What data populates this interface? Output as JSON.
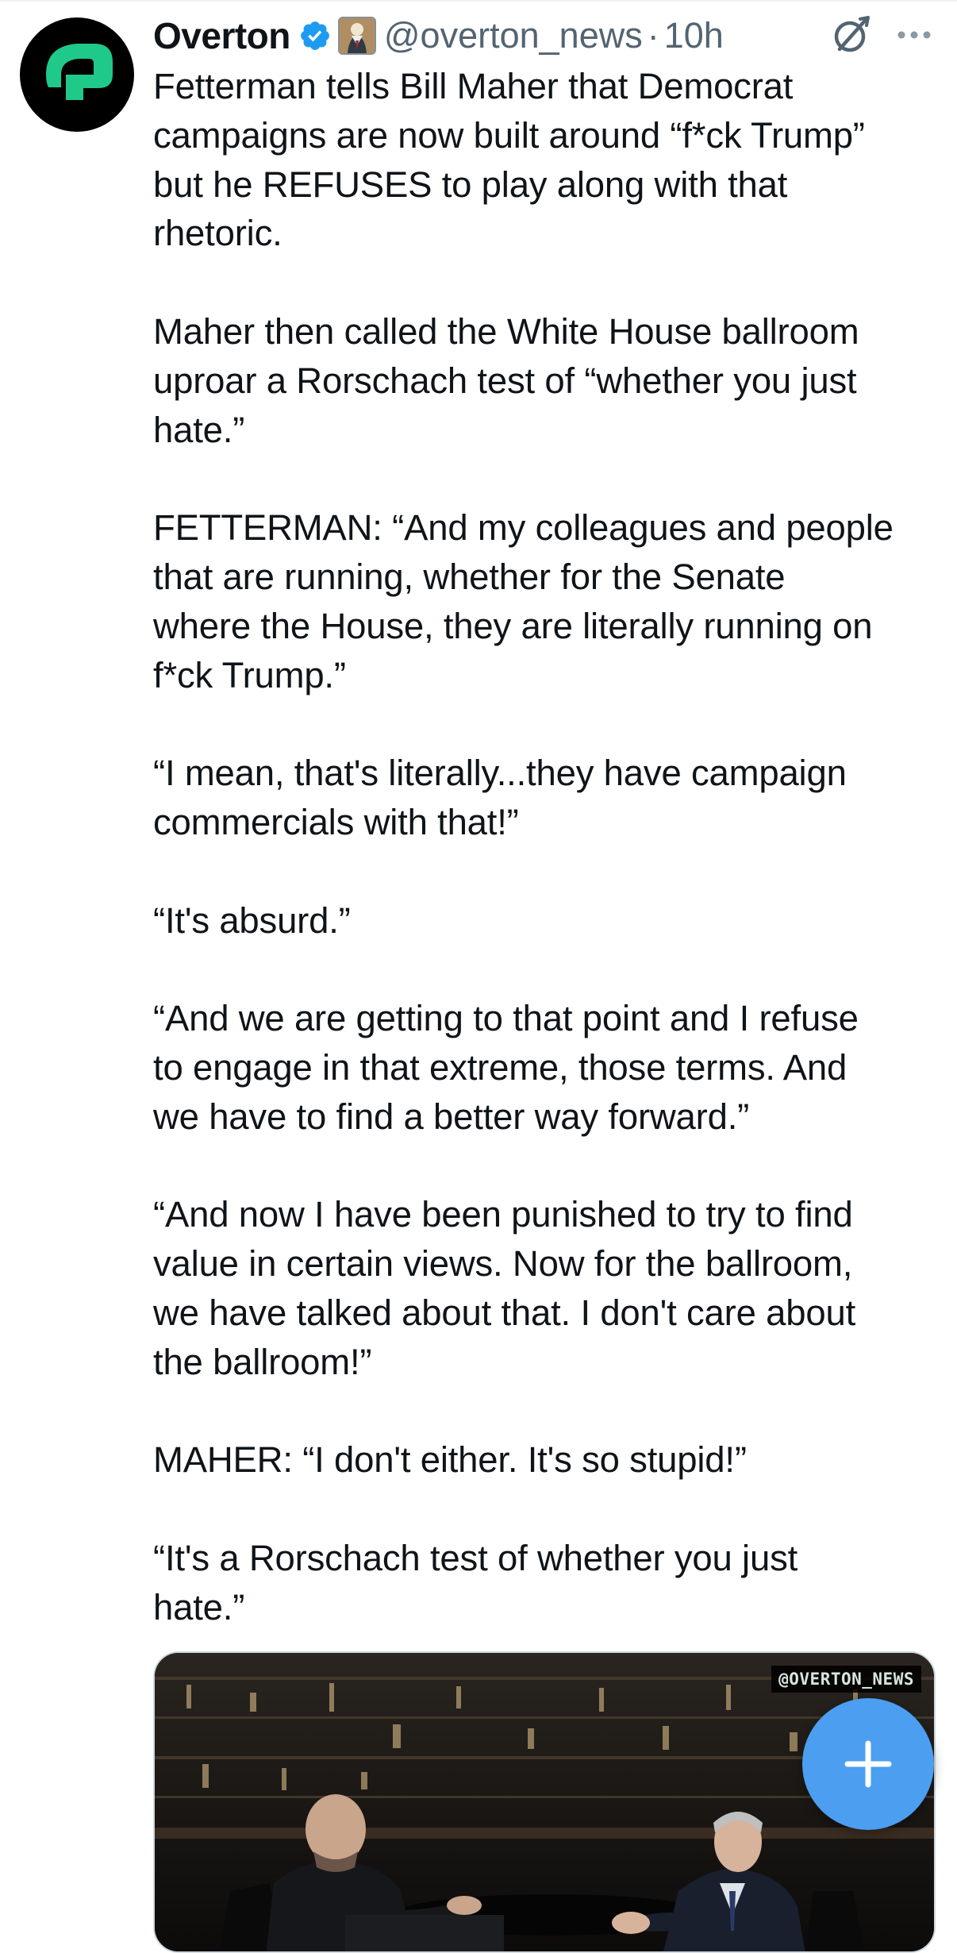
{
  "tweet": {
    "display_name": "Overton",
    "handle": "@overton_news",
    "separator": "·",
    "time": "10h",
    "text": "Fetterman tells Bill Maher that Democrat\ncampaigns are now built around “f*ck Trump”\nbut he REFUSES to play along with that\nrhetoric.\n\nMaher then called the White House ballroom\nuproar a Rorschach test of “whether you just\nhate.”\n\nFETTERMAN: “And my colleagues and people\nthat are running, whether for the Senate\nwhere the House, they are literally running on\nf*ck Trump.”\n\n“I mean, that's literally...they have campaign\ncommercials with that!”\n\n“It's absurd.”\n\n“And we are getting to that point and I refuse\nto engage in that extreme, those terms. And\nwe have to find a better way forward.”\n\n“And now I have been punished to try to find\nvalue in certain views. Now for the ballroom,\nwe have talked about that. I don't care about\nthe ballroom!”\n\nMAHER: “I don't either. It's so stupid!”\n\n“It's a Rorschach test of whether you just\nhate.”",
    "media_watermark": "@OVERTON_NEWS"
  },
  "icons": {
    "avatar": "overton-logo",
    "verified": "verified-badge-icon",
    "affiliate": "affiliate-badge-icon",
    "grok": "grok-icon",
    "more": "more-icon",
    "compose": "plus-icon"
  },
  "colors": {
    "text": "#0f1419",
    "secondary": "#536471",
    "verified": "#1d9bf0",
    "compose_button": "#4c9ef0",
    "avatar_bg": "#000000",
    "logo_green": "#1ec98a"
  }
}
